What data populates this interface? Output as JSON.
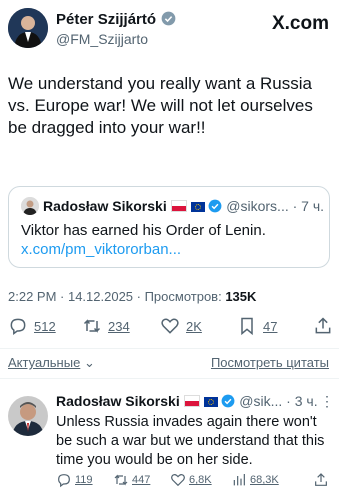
{
  "header": {
    "name": "Péter Szijjártó",
    "handle": "@FM_Szijjarto",
    "brand": "X.com"
  },
  "tweet": {
    "text": "We understand you really want a Russia vs. Europe war! We will not let ourselves be dragged into your war!!",
    "quote": {
      "name": "Radosław Sikorski",
      "handle": "@sikors...",
      "time": "· 7 ч.",
      "text": "Viktor has earned his Order of Lenin.",
      "link": "x.com/pm_viktororban..."
    },
    "meta": {
      "time": "2:22 PM · 14.12.2025 · Просмотров:",
      "views": "135K"
    },
    "actions": {
      "replies": "512",
      "reposts": "234",
      "likes": "2K",
      "bookmarks": "47"
    }
  },
  "sortbar": {
    "left": "Актуальные",
    "right": "Посмотреть цитаты"
  },
  "reply": {
    "name": "Radosław Sikorski",
    "handle": "@sik...",
    "time": "· 3 ч.",
    "text": "Unless Russia invades again there won't be such a war but we understand that this time you would be on her side.",
    "actions": {
      "replies": "119",
      "reposts": "447",
      "likes": "6,8K",
      "views": "68,3K"
    }
  },
  "colors": {
    "accent": "#1d9bf0",
    "text": "#0f1419",
    "muted": "#536471"
  }
}
